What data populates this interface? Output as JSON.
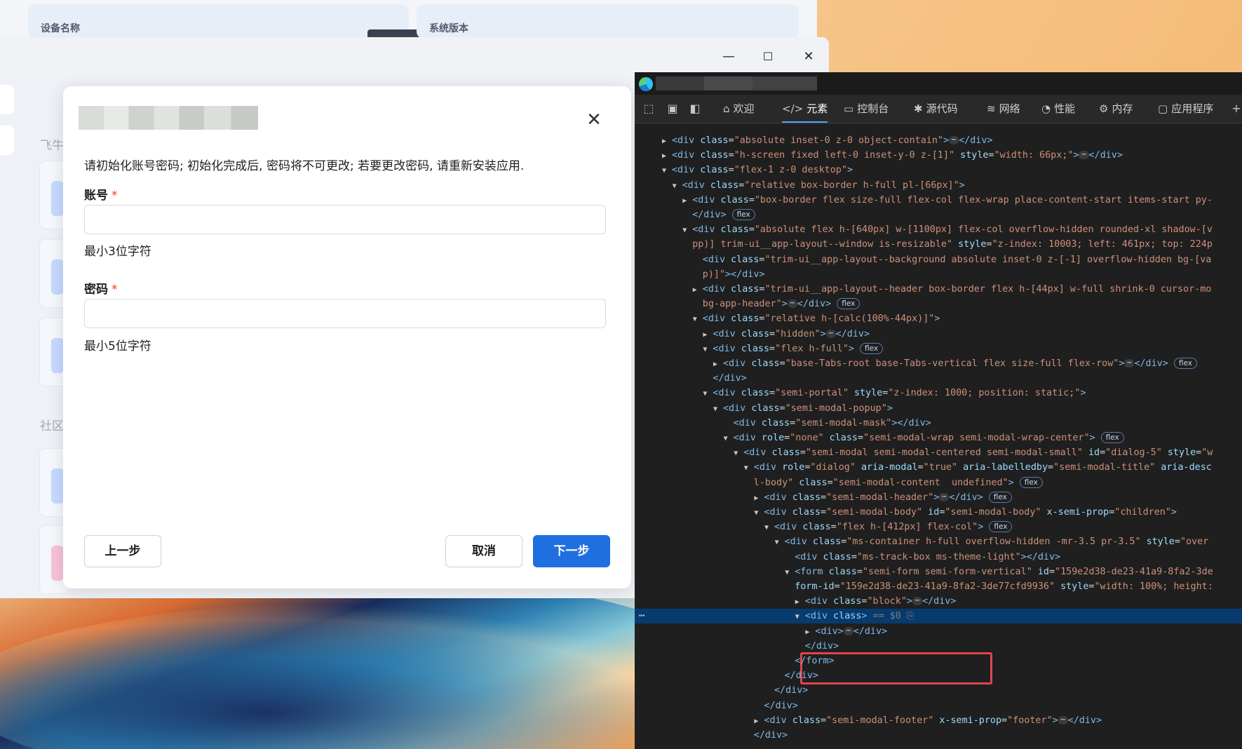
{
  "background_app": {
    "card_device_label": "设备名称",
    "card_version_label": "系统版本",
    "fragment_texts": [
      "飞牛",
      "社区"
    ]
  },
  "window_controls": {
    "minimize": "—",
    "maximize": "☐",
    "close": "✕"
  },
  "modal": {
    "close_symbol": "✕",
    "description": "请初始化账号密码; 初始化完成后, 密码将不可更改; 若要更改密码, 请重新安装应用.",
    "account": {
      "label": "账号",
      "required_mark": "*",
      "value": "",
      "hint": "最小3位字符"
    },
    "password": {
      "label": "密码",
      "required_mark": "*",
      "value": "",
      "hint": "最小5位字符"
    },
    "buttons": {
      "prev": "上一步",
      "cancel": "取消",
      "next": "下一步"
    }
  },
  "devtools": {
    "tabs": [
      {
        "icon": "home-icon",
        "glyph": "⌂",
        "label": "欢迎"
      },
      {
        "icon": "code-icon",
        "glyph": "</>",
        "label": "元素",
        "active": true
      },
      {
        "icon": "console-icon",
        "glyph": "▭",
        "label": "控制台"
      },
      {
        "icon": "bug-icon",
        "glyph": "✱",
        "label": "源代码"
      },
      {
        "icon": "wifi-icon",
        "glyph": "≋",
        "label": "网络"
      },
      {
        "icon": "gauge-icon",
        "glyph": "◔",
        "label": "性能"
      },
      {
        "icon": "gear-icon",
        "glyph": "⚙",
        "label": "内存"
      },
      {
        "icon": "app-icon",
        "glyph": "▢",
        "label": "应用程序"
      }
    ],
    "lines": [
      {
        "indent": 5,
        "arrow": "right",
        "html": "<span class='tg'>&lt;div</span> <span class='at'>class</span><span class='pl'>=</span><span class='av'>\"absolute inset-0 z-0 object-contain\"</span><span class='tg'>&gt;</span><span class='el'>⋯</span><span class='tg'>&lt;/div&gt;</span>"
      },
      {
        "indent": 5,
        "arrow": "right",
        "html": "<span class='tg'>&lt;div</span> <span class='at'>class</span><span class='pl'>=</span><span class='av'>\"h-screen fixed left-0 inset-y-0 z-[1]\"</span> <span class='at'>style</span><span class='pl'>=</span><span class='av'>\"width: 66px;\"</span><span class='tg'>&gt;</span><span class='el'>⋯</span><span class='tg'>&lt;/div&gt;</span>"
      },
      {
        "indent": 5,
        "arrow": "down",
        "html": "<span class='tg'>&lt;div</span> <span class='at'>class</span><span class='pl'>=</span><span class='av'>\"flex-1 z-0 desktop\"</span><span class='tg'>&gt;</span>"
      },
      {
        "indent": 6,
        "arrow": "down",
        "html": "<span class='tg'>&lt;div</span> <span class='at'>class</span><span class='pl'>=</span><span class='av'>\"relative box-border h-full pl-[66px]\"</span><span class='tg'>&gt;</span>"
      },
      {
        "indent": 7,
        "arrow": "right",
        "html": "<span class='tg'>&lt;div</span> <span class='at'>class</span><span class='pl'>=</span><span class='av'>\"box-border flex size-full flex-col flex-wrap place-content-start items-start py-</span>"
      },
      {
        "indent": 7,
        "arrow": "",
        "html": "<span class='tg'>&lt;/div&gt;</span> <span class='fb'>flex</span>"
      },
      {
        "indent": 7,
        "arrow": "down",
        "html": "<span class='tg'>&lt;div</span> <span class='at'>class</span><span class='pl'>=</span><span class='av'>\"absolute flex h-[640px] w-[1100px] flex-col overflow-hidden rounded-xl shadow-[v</span>"
      },
      {
        "indent": 7,
        "arrow": "",
        "html": "<span class='av'>pp)] trim-ui__app-layout--window is-resizable\"</span> <span class='at'>style</span><span class='pl'>=</span><span class='av'>\"z-index: 10003; left: 461px; top: 224p</span>"
      },
      {
        "indent": 8,
        "arrow": "",
        "html": "<span class='tg'>&lt;div</span> <span class='at'>class</span><span class='pl'>=</span><span class='av'>\"trim-ui__app-layout--background absolute inset-0 z-[-1] overflow-hidden bg-[va</span>"
      },
      {
        "indent": 8,
        "arrow": "",
        "html": "<span class='av'>p)]\"</span><span class='tg'>&gt;&lt;/div&gt;</span>"
      },
      {
        "indent": 8,
        "arrow": "right",
        "html": "<span class='tg'>&lt;div</span> <span class='at'>class</span><span class='pl'>=</span><span class='av'>\"trim-ui__app-layout--header box-border flex h-[44px] w-full shrink-0 cursor-mo</span>"
      },
      {
        "indent": 8,
        "arrow": "",
        "html": "<span class='av'>bg-app-header\"</span><span class='tg'>&gt;</span><span class='el'>⋯</span><span class='tg'>&lt;/div&gt;</span> <span class='fb'>flex</span>"
      },
      {
        "indent": 8,
        "arrow": "down",
        "html": "<span class='tg'>&lt;div</span> <span class='at'>class</span><span class='pl'>=</span><span class='av'>\"relative h-[calc(100%-44px)]\"</span><span class='tg'>&gt;</span>"
      },
      {
        "indent": 9,
        "arrow": "right",
        "html": "<span class='tg'>&lt;div</span> <span class='at'>class</span><span class='pl'>=</span><span class='av'>\"hidden\"</span><span class='tg'>&gt;</span><span class='el'>⋯</span><span class='tg'>&lt;/div&gt;</span>"
      },
      {
        "indent": 9,
        "arrow": "down",
        "html": "<span class='tg'>&lt;div</span> <span class='at'>class</span><span class='pl'>=</span><span class='av'>\"flex h-full\"</span><span class='tg'>&gt;</span> <span class='fb'>flex</span>"
      },
      {
        "indent": 10,
        "arrow": "right",
        "html": "<span class='tg'>&lt;div</span> <span class='at'>class</span><span class='pl'>=</span><span class='av'>\"base-Tabs-root base-Tabs-vertical flex size-full flex-row\"</span><span class='tg'>&gt;</span><span class='el'>⋯</span><span class='tg'>&lt;/div&gt;</span> <span class='fb'>flex</span>"
      },
      {
        "indent": 9,
        "arrow": "",
        "html": "<span class='tg'>&lt;/div&gt;</span>"
      },
      {
        "indent": 9,
        "arrow": "down",
        "html": "<span class='tg'>&lt;div</span> <span class='at'>class</span><span class='pl'>=</span><span class='av'>\"semi-portal\"</span> <span class='at'>style</span><span class='pl'>=</span><span class='av'>\"z-index: 1000; position: static;\"</span><span class='tg'>&gt;</span>"
      },
      {
        "indent": 10,
        "arrow": "down",
        "html": "<span class='tg'>&lt;div</span> <span class='at'>class</span><span class='pl'>=</span><span class='av'>\"semi-modal-popup\"</span><span class='tg'>&gt;</span>"
      },
      {
        "indent": 11,
        "arrow": "",
        "html": "<span class='tg'>&lt;div</span> <span class='at'>class</span><span class='pl'>=</span><span class='av'>\"semi-modal-mask\"</span><span class='tg'>&gt;&lt;/div&gt;</span>"
      },
      {
        "indent": 11,
        "arrow": "down",
        "html": "<span class='tg'>&lt;div</span> <span class='at'>role</span><span class='pl'>=</span><span class='av'>\"none\"</span> <span class='at'>class</span><span class='pl'>=</span><span class='av'>\"semi-modal-wrap semi-modal-wrap-center\"</span><span class='tg'>&gt;</span> <span class='fb'>flex</span>"
      },
      {
        "indent": 12,
        "arrow": "down",
        "html": "<span class='tg'>&lt;div</span> <span class='at'>class</span><span class='pl'>=</span><span class='av'>\"semi-modal semi-modal-centered semi-modal-small\"</span> <span class='at'>id</span><span class='pl'>=</span><span class='av'>\"dialog-5\"</span> <span class='at'>style</span><span class='pl'>=</span><span class='av'>\"w</span>"
      },
      {
        "indent": 13,
        "arrow": "down",
        "html": "<span class='tg'>&lt;div</span> <span class='at'>role</span><span class='pl'>=</span><span class='av'>\"dialog\"</span> <span class='at'>aria-modal</span><span class='pl'>=</span><span class='av'>\"true\"</span> <span class='at'>aria-labelledby</span><span class='pl'>=</span><span class='av'>\"semi-modal-title\"</span> <span class='at'>aria-desc</span>"
      },
      {
        "indent": 13,
        "arrow": "",
        "html": "<span class='av'>l-body\"</span> <span class='at'>class</span><span class='pl'>=</span><span class='av'>\"semi-modal-content  undefined\"</span><span class='tg'>&gt;</span> <span class='fb'>flex</span>"
      },
      {
        "indent": 14,
        "arrow": "right",
        "html": "<span class='tg'>&lt;div</span> <span class='at'>class</span><span class='pl'>=</span><span class='av'>\"semi-modal-header\"</span><span class='tg'>&gt;</span><span class='el'>⋯</span><span class='tg'>&lt;/div&gt;</span> <span class='fb'>flex</span>"
      },
      {
        "indent": 14,
        "arrow": "down",
        "html": "<span class='tg'>&lt;div</span> <span class='at'>class</span><span class='pl'>=</span><span class='av'>\"semi-modal-body\"</span> <span class='at'>id</span><span class='pl'>=</span><span class='av'>\"semi-modal-body\"</span> <span class='at'>x-semi-prop</span><span class='pl'>=</span><span class='av'>\"children\"</span><span class='tg'>&gt;</span>"
      },
      {
        "indent": 15,
        "arrow": "down",
        "html": "<span class='tg'>&lt;div</span> <span class='at'>class</span><span class='pl'>=</span><span class='av'>\"flex h-[412px] flex-col\"</span><span class='tg'>&gt;</span> <span class='fb'>flex</span>"
      },
      {
        "indent": 16,
        "arrow": "down",
        "html": "<span class='tg'>&lt;div</span> <span class='at'>class</span><span class='pl'>=</span><span class='av'>\"ms-container h-full overflow-hidden -mr-3.5 pr-3.5\"</span> <span class='at'>style</span><span class='pl'>=</span><span class='av'>\"over</span>"
      },
      {
        "indent": 17,
        "arrow": "",
        "html": "<span class='tg'>&lt;div</span> <span class='at'>class</span><span class='pl'>=</span><span class='av'>\"ms-track-box ms-theme-light\"</span><span class='tg'>&gt;&lt;/div&gt;</span>"
      },
      {
        "indent": 17,
        "arrow": "down",
        "html": "<span class='tg'>&lt;form</span> <span class='at'>class</span><span class='pl'>=</span><span class='av'>\"semi-form semi-form-vertical\"</span> <span class='at'>id</span><span class='pl'>=</span><span class='av'>\"159e2d38-de23-41a9-8fa2-3de</span>"
      },
      {
        "indent": 17,
        "arrow": "",
        "html": "<span class='at'>form-id</span><span class='pl'>=</span><span class='av'>\"159e2d38-de23-41a9-8fa2-3de77cfd9936\"</span> <span class='at'>style</span><span class='pl'>=</span><span class='av'>\"width: 100%; height:</span>"
      },
      {
        "indent": 18,
        "arrow": "right",
        "html": "<span class='tg'>&lt;div</span> <span class='at'>class</span><span class='pl'>=</span><span class='av'>\"block\"</span><span class='tg'>&gt;</span><span class='el'>⋯</span><span class='tg'>&lt;/div&gt;</span>"
      },
      {
        "indent": 18,
        "arrow": "down",
        "sel": true,
        "html": "<span class='tg'>&lt;div</span> <span class='at'>class</span><span class='tg'>&gt;</span> <span class='dim'>== $0</span> <span class='dim'>⎘</span>"
      },
      {
        "indent": 19,
        "arrow": "right",
        "html": "<span class='tg'>&lt;div&gt;</span><span class='el'>⋯</span><span class='tg'>&lt;/div&gt;</span>"
      },
      {
        "indent": 18,
        "arrow": "",
        "html": "<span class='tg'>&lt;/div&gt;</span>"
      },
      {
        "indent": 17,
        "arrow": "",
        "html": "<span class='tg'>&lt;/form&gt;</span>"
      },
      {
        "indent": 16,
        "arrow": "",
        "html": "<span class='tg'>&lt;/div&gt;</span>"
      },
      {
        "indent": 15,
        "arrow": "",
        "html": "<span class='tg'>&lt;/div&gt;</span>"
      },
      {
        "indent": 14,
        "arrow": "",
        "html": "<span class='tg'>&lt;/div&gt;</span>"
      },
      {
        "indent": 14,
        "arrow": "right",
        "html": "<span class='tg'>&lt;div</span> <span class='at'>class</span><span class='pl'>=</span><span class='av'>\"semi-modal-footer\"</span> <span class='at'>x-semi-prop</span><span class='pl'>=</span><span class='av'>\"footer\"</span><span class='tg'>&gt;</span><span class='el'>⋯</span><span class='tg'>&lt;/div&gt;</span>"
      },
      {
        "indent": 13,
        "arrow": "",
        "html": "<span class='tg'>&lt;/div&gt;</span>"
      }
    ]
  },
  "colors": {
    "primary": "#1f6fe0",
    "required": "#f93920",
    "highlight_box": "#e0454f",
    "selected_row": "#073b6e"
  }
}
